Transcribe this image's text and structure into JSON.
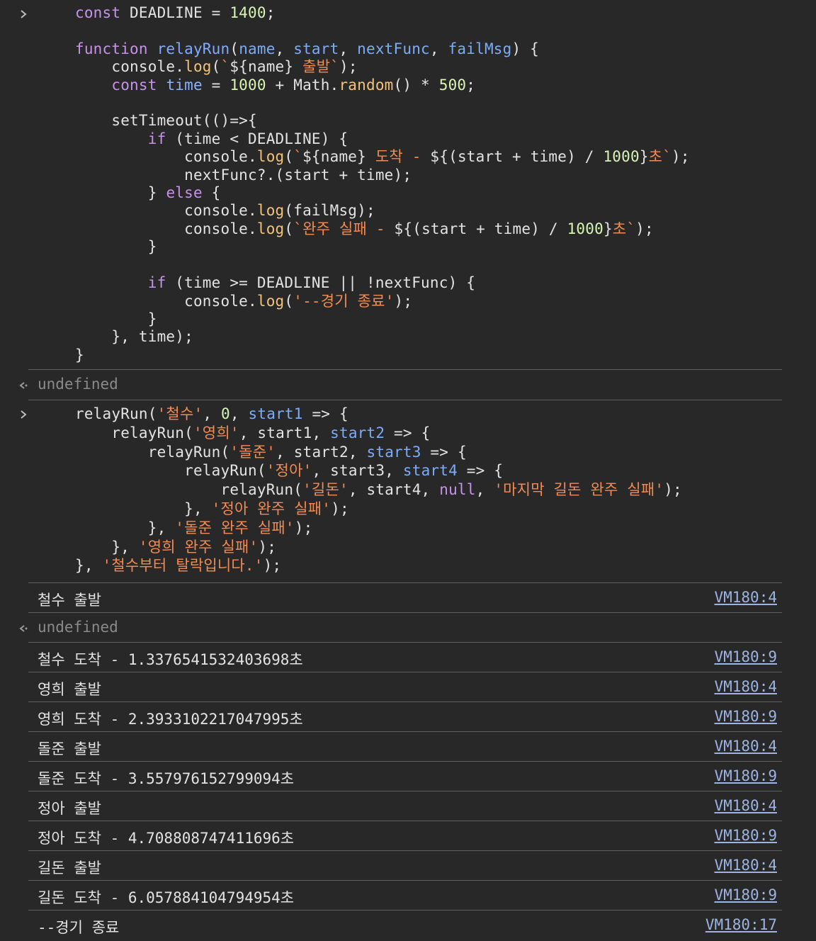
{
  "input1": {
    "lines": [
      [
        [
          "k",
          "const"
        ],
        [
          "t",
          " DEADLINE = "
        ],
        [
          "n",
          "1400"
        ],
        [
          "t",
          ";"
        ]
      ],
      [
        [
          "t",
          ""
        ]
      ],
      [
        [
          "k",
          "function"
        ],
        [
          "t",
          " "
        ],
        [
          "fn",
          "relayRun"
        ],
        [
          "t",
          "("
        ],
        [
          "pm",
          "name"
        ],
        [
          "t",
          ", "
        ],
        [
          "pm",
          "start"
        ],
        [
          "t",
          ", "
        ],
        [
          "pm",
          "nextFunc"
        ],
        [
          "t",
          ", "
        ],
        [
          "pm",
          "failMsg"
        ],
        [
          "t",
          ") {"
        ]
      ],
      [
        [
          "t",
          "    console."
        ],
        [
          "m",
          "log"
        ],
        [
          "t",
          "("
        ],
        [
          "s",
          "`"
        ],
        [
          "t",
          "${name}"
        ],
        [
          "s",
          " 출발`"
        ],
        [
          "t",
          ");"
        ]
      ],
      [
        [
          "t",
          "    "
        ],
        [
          "k",
          "const"
        ],
        [
          "t",
          " "
        ],
        [
          "kb",
          "time"
        ],
        [
          "t",
          " = "
        ],
        [
          "n",
          "1000"
        ],
        [
          "t",
          " + Math."
        ],
        [
          "m",
          "random"
        ],
        [
          "t",
          "() * "
        ],
        [
          "n",
          "500"
        ],
        [
          "t",
          ";"
        ]
      ],
      [
        [
          "t",
          ""
        ]
      ],
      [
        [
          "t",
          "    setTimeout(()=>{"
        ]
      ],
      [
        [
          "t",
          "        "
        ],
        [
          "k",
          "if"
        ],
        [
          "t",
          " (time < DEADLINE) {"
        ]
      ],
      [
        [
          "t",
          "            console."
        ],
        [
          "m",
          "log"
        ],
        [
          "t",
          "("
        ],
        [
          "s",
          "`"
        ],
        [
          "t",
          "${name}"
        ],
        [
          "s",
          " 도착 - "
        ],
        [
          "t",
          "${(start + time) / "
        ],
        [
          "n",
          "1000"
        ],
        [
          "t",
          "}"
        ],
        [
          "s",
          "초`"
        ],
        [
          "t",
          ");"
        ]
      ],
      [
        [
          "t",
          "            nextFunc?.(start + time);"
        ]
      ],
      [
        [
          "t",
          "        } "
        ],
        [
          "k",
          "else"
        ],
        [
          "t",
          " {"
        ]
      ],
      [
        [
          "t",
          "            console."
        ],
        [
          "m",
          "log"
        ],
        [
          "t",
          "(failMsg);"
        ]
      ],
      [
        [
          "t",
          "            console."
        ],
        [
          "m",
          "log"
        ],
        [
          "t",
          "("
        ],
        [
          "s",
          "`완주 실패 - "
        ],
        [
          "t",
          "${(start + time) / "
        ],
        [
          "n",
          "1000"
        ],
        [
          "t",
          "}"
        ],
        [
          "s",
          "초`"
        ],
        [
          "t",
          ");"
        ]
      ],
      [
        [
          "t",
          "        }"
        ]
      ],
      [
        [
          "t",
          ""
        ]
      ],
      [
        [
          "t",
          "        "
        ],
        [
          "k",
          "if"
        ],
        [
          "t",
          " (time >= DEADLINE || !nextFunc) {"
        ]
      ],
      [
        [
          "t",
          "            console."
        ],
        [
          "m",
          "log"
        ],
        [
          "t",
          "("
        ],
        [
          "s",
          "'--경기 종료'"
        ],
        [
          "t",
          ");"
        ]
      ],
      [
        [
          "t",
          "        }"
        ]
      ],
      [
        [
          "t",
          "    }, time);"
        ]
      ],
      [
        [
          "t",
          "}"
        ]
      ]
    ]
  },
  "return1": {
    "text": "undefined"
  },
  "input2": {
    "lines": [
      [
        [
          "t",
          "relayRun("
        ],
        [
          "s",
          "'철수'"
        ],
        [
          "t",
          ", "
        ],
        [
          "n",
          "0"
        ],
        [
          "t",
          ", "
        ],
        [
          "pm",
          "start1"
        ],
        [
          "t",
          " => {"
        ]
      ],
      [
        [
          "t",
          "    relayRun("
        ],
        [
          "s",
          "'영희'"
        ],
        [
          "t",
          ", start1, "
        ],
        [
          "pm",
          "start2"
        ],
        [
          "t",
          " => {"
        ]
      ],
      [
        [
          "t",
          "        relayRun("
        ],
        [
          "s",
          "'돌준'"
        ],
        [
          "t",
          ", start2, "
        ],
        [
          "pm",
          "start3"
        ],
        [
          "t",
          " => {"
        ]
      ],
      [
        [
          "t",
          "            relayRun("
        ],
        [
          "s",
          "'정아'"
        ],
        [
          "t",
          ", start3, "
        ],
        [
          "pm",
          "start4"
        ],
        [
          "t",
          " => {"
        ]
      ],
      [
        [
          "t",
          "                relayRun("
        ],
        [
          "s",
          "'길돈'"
        ],
        [
          "t",
          ", start4, "
        ],
        [
          "k",
          "null"
        ],
        [
          "t",
          ", "
        ],
        [
          "s",
          "'마지막 길돈 완주 실패'"
        ],
        [
          "t",
          ");"
        ]
      ],
      [
        [
          "t",
          "            }, "
        ],
        [
          "s",
          "'정아 완주 실패'"
        ],
        [
          "t",
          ");"
        ]
      ],
      [
        [
          "t",
          "        }, "
        ],
        [
          "s",
          "'돌준 완주 실패'"
        ],
        [
          "t",
          ");"
        ]
      ],
      [
        [
          "t",
          "    }, "
        ],
        [
          "s",
          "'영희 완주 실패'"
        ],
        [
          "t",
          ");"
        ]
      ],
      [
        [
          "t",
          "}, "
        ],
        [
          "s",
          "'철수부터 탈락입니다.'"
        ],
        [
          "t",
          ");"
        ]
      ]
    ]
  },
  "log_first": {
    "text": "철수 출발",
    "source": "VM180:4"
  },
  "return2": {
    "text": "undefined"
  },
  "logs": [
    {
      "text": "철수 도착 - 1.3376541532403698초",
      "source": "VM180:9"
    },
    {
      "text": "영희 출발",
      "source": "VM180:4"
    },
    {
      "text": "영희 도착 - 2.3933102217047995초",
      "source": "VM180:9"
    },
    {
      "text": "돌준 출발",
      "source": "VM180:4"
    },
    {
      "text": "돌준 도착 - 3.557976152799094초",
      "source": "VM180:9"
    },
    {
      "text": "정아 출발",
      "source": "VM180:4"
    },
    {
      "text": "정아 도착 - 4.708808747411696초",
      "source": "VM180:9"
    },
    {
      "text": "길돈 출발",
      "source": "VM180:4"
    },
    {
      "text": "길돈 도착 - 6.057884104794954초",
      "source": "VM180:9"
    },
    {
      "text": "--경기 종료",
      "source": "VM180:17"
    }
  ],
  "colors": {
    "background": "#282828",
    "keyword": "#c792ea",
    "string": "#f28b54",
    "number": "#d9f5b5",
    "link": "#9db4e3",
    "muted": "#8a8a8a"
  },
  "icons": {
    "prompt": "chevron-right-icon",
    "return": "return-arrow-icon"
  }
}
